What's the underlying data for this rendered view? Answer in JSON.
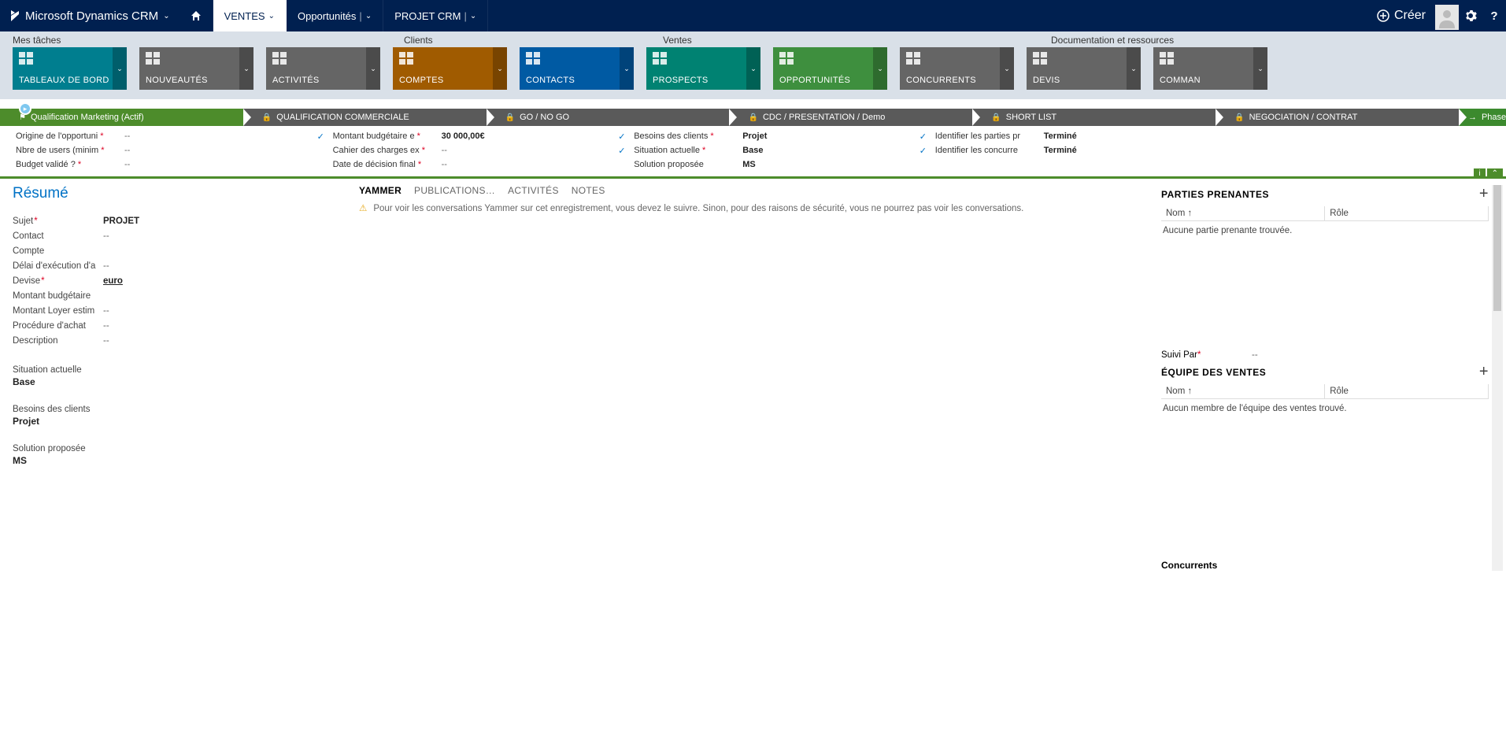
{
  "topnav": {
    "brand": "Microsoft Dynamics CRM",
    "items": [
      "VENTES",
      "Opportunités",
      "PROJET CRM"
    ],
    "creer": "Créer"
  },
  "sections": {
    "taches": "Mes tâches",
    "clients": "Clients",
    "ventes": "Ventes",
    "docs": "Documentation et ressources"
  },
  "tiles": [
    {
      "label": "TABLEAUX DE BORD",
      "color": "teal"
    },
    {
      "label": "NOUVEAUTÉS",
      "color": "gray"
    },
    {
      "label": "ACTIVITÉS",
      "color": "gray2"
    },
    {
      "label": "COMPTES",
      "color": "brown"
    },
    {
      "label": "CONTACTS",
      "color": "blue"
    },
    {
      "label": "PROSPECTS",
      "color": "teal2"
    },
    {
      "label": "OPPORTUNITÉS",
      "color": "green"
    },
    {
      "label": "CONCURRENTS",
      "color": "gray"
    },
    {
      "label": "DEVIS",
      "color": "gray"
    },
    {
      "label": "COMMAN",
      "color": "gray"
    }
  ],
  "stages": [
    {
      "label": "Qualification Marketing (Actif)",
      "active": true,
      "locked": false
    },
    {
      "label": "QUALIFICATION COMMERCIALE",
      "active": false,
      "locked": true
    },
    {
      "label": "GO / NO GO",
      "active": false,
      "locked": true
    },
    {
      "label": "CDC / PRESENTATION / Demo",
      "active": false,
      "locked": true
    },
    {
      "label": "SHORT LIST",
      "active": false,
      "locked": true
    },
    {
      "label": "NEGOCIATION / CONTRAT",
      "active": false,
      "locked": true
    }
  ],
  "stage_next": "Phase Sui…",
  "stage_details": {
    "col1": [
      {
        "label": "Origine de l'opportuni",
        "req": true,
        "val": "--"
      },
      {
        "label": "Nbre de users (minim",
        "req": true,
        "val": "--"
      },
      {
        "label": "Budget validé ?",
        "req": true,
        "val": "--"
      }
    ],
    "col2": [
      {
        "check": true,
        "label": "Montant budgétaire e",
        "req": true,
        "val": "30 000,00€"
      },
      {
        "check": false,
        "label": "Cahier des charges ex",
        "req": true,
        "val": "--"
      },
      {
        "check": false,
        "label": "Date de décision final",
        "req": true,
        "val": "--"
      }
    ],
    "col3": [
      {
        "check": true,
        "label": "Besoins des clients",
        "req": true,
        "val": "Projet"
      },
      {
        "check": true,
        "label": "Situation actuelle",
        "req": true,
        "val": "Base"
      },
      {
        "check": false,
        "label": "Solution proposée",
        "req": false,
        "val": "MS"
      }
    ],
    "col4": [
      {
        "check": true,
        "label": "Identifier les parties pr",
        "req": false,
        "val": "Terminé"
      },
      {
        "check": true,
        "label": "Identifier les concurre",
        "req": false,
        "val": "Terminé"
      }
    ]
  },
  "resume": {
    "title": "Résumé",
    "rows": [
      {
        "label": "Sujet",
        "req": true,
        "val": "PROJET",
        "bold": true
      },
      {
        "label": "Contact",
        "req": false,
        "val": "--"
      },
      {
        "label": "Compte",
        "req": false,
        "val": ""
      },
      {
        "label": "Délai d'exécution d'a",
        "req": false,
        "val": "--"
      },
      {
        "label": "Devise",
        "req": true,
        "val": "euro",
        "link": true
      },
      {
        "label": "Montant budgétaire",
        "req": false,
        "val": ""
      },
      {
        "label": "Montant Loyer estim",
        "req": false,
        "val": "--"
      },
      {
        "label": "Procédure d'achat",
        "req": false,
        "val": "--"
      },
      {
        "label": "Description",
        "req": false,
        "val": "--"
      }
    ],
    "blocks": [
      {
        "label": "Situation actuelle",
        "val": "Base"
      },
      {
        "label": "Besoins des clients",
        "val": "Projet"
      },
      {
        "label": "Solution proposée",
        "val": "MS"
      }
    ]
  },
  "midtabs": [
    "YAMMER",
    "PUBLICATIONS…",
    "ACTIVITÉS",
    "NOTES"
  ],
  "yammer_msg": "Pour voir les conversations Yammer sur cet enregistrement, vous devez le suivre. Sinon, pour des raisons de sécurité, vous ne pourrez pas voir les conversations.",
  "right": {
    "parties": {
      "title": "PARTIES PRENANTES",
      "cols": [
        "Nom ↑",
        "Rôle"
      ],
      "empty": "Aucune partie prenante trouvée."
    },
    "suivi": {
      "label": "Suivi Par",
      "req": true,
      "val": "--"
    },
    "equipe": {
      "title": "ÉQUIPE DES VENTES",
      "cols": [
        "Nom ↑",
        "Rôle"
      ],
      "empty": "Aucun membre de l'équipe des ventes trouvé."
    },
    "concurrents": "Concurrents"
  }
}
